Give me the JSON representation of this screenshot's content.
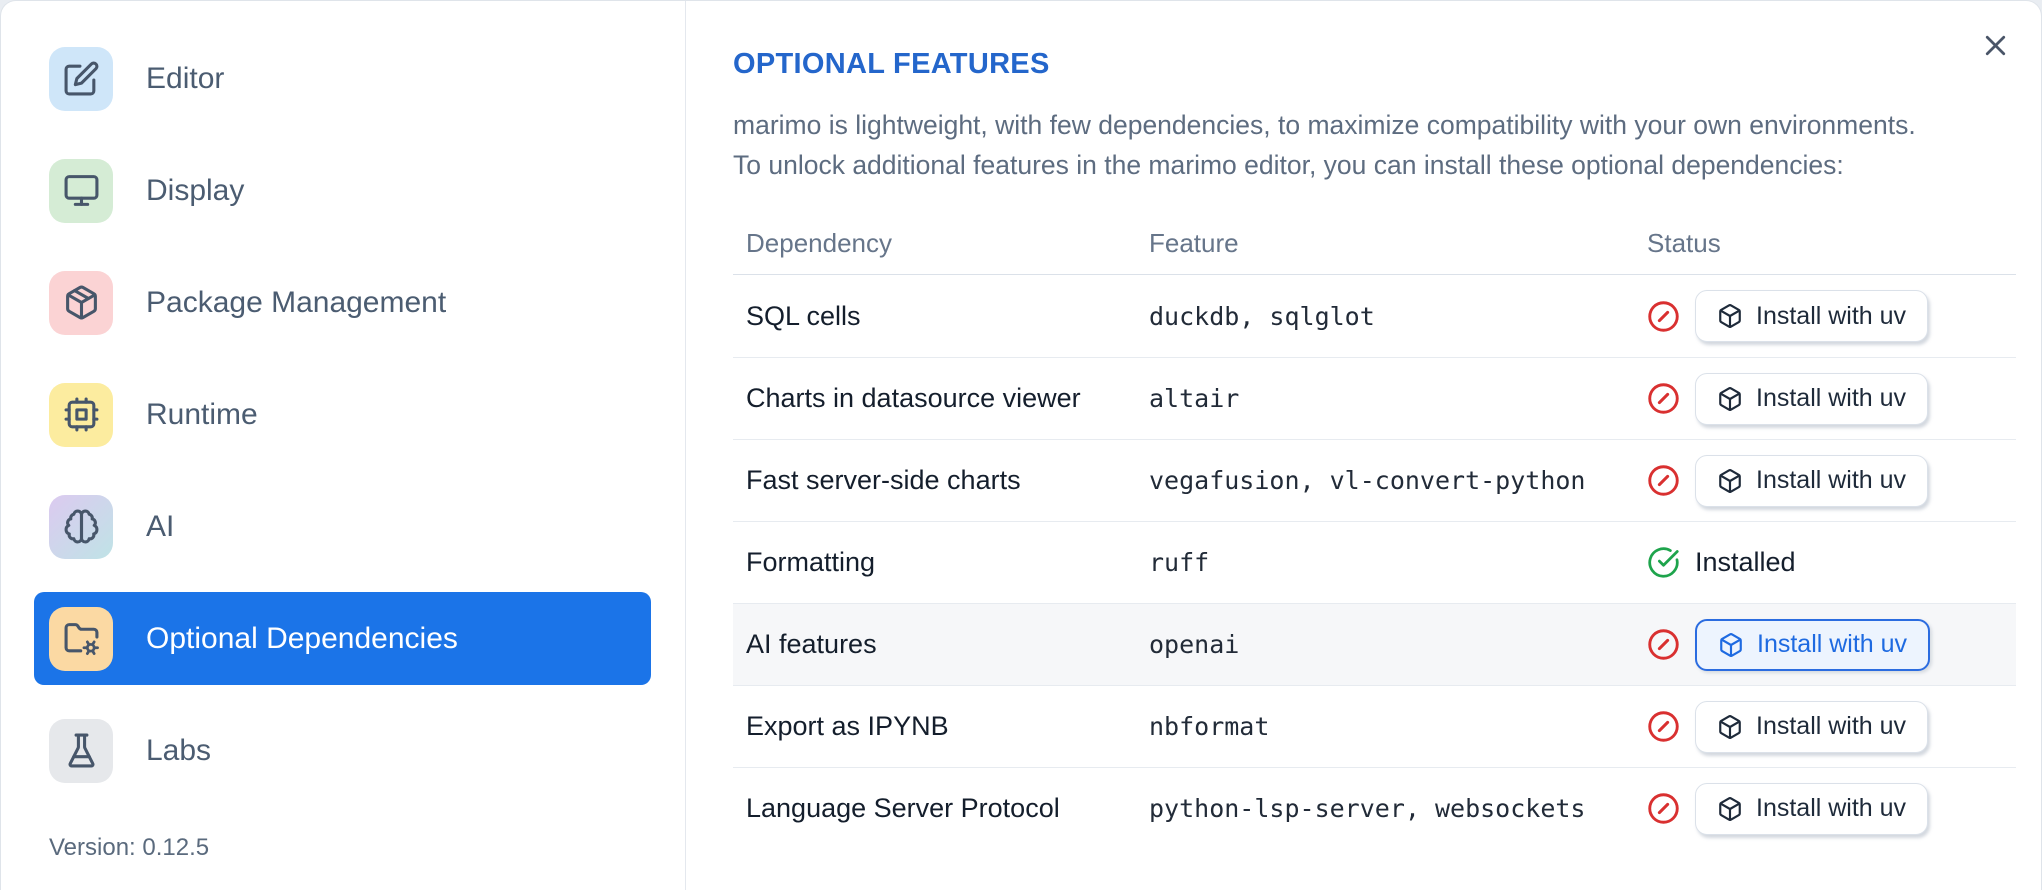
{
  "sidebar": {
    "items": [
      {
        "label": "Editor",
        "icon": "edit-icon",
        "tile_bg": "#cfe6f9"
      },
      {
        "label": "Display",
        "icon": "monitor-icon",
        "tile_bg": "#d5ecd5"
      },
      {
        "label": "Package Management",
        "icon": "package-icon",
        "tile_bg": "#fbd3d4"
      },
      {
        "label": "Runtime",
        "icon": "cpu-icon",
        "tile_bg": "#fcec9f"
      },
      {
        "label": "AI",
        "icon": "brain-icon",
        "tile_bg": "linear-gradient(135deg,#dccaf0 0%,#bfe3e6 100%)"
      },
      {
        "label": "Optional Dependencies",
        "icon": "folder-cog-icon",
        "tile_bg": "#fbd9a3",
        "selected": true
      },
      {
        "label": "Labs",
        "icon": "flask-icon",
        "tile_bg": "#e6e8eb"
      }
    ],
    "version": "Version: 0.12.5"
  },
  "dialog": {
    "title": "OPTIONAL FEATURES",
    "description_line1": "marimo is lightweight, with few dependencies, to maximize compatibility with your own environments.",
    "description_line2": "To unlock additional features in the marimo editor, you can install these optional dependencies:"
  },
  "table": {
    "headers": [
      "Dependency",
      "Feature",
      "Status"
    ],
    "rows": [
      {
        "dependency": "SQL cells",
        "feature": "duckdb, sqlglot",
        "status": "not-installed",
        "action": "Install with uv"
      },
      {
        "dependency": "Charts in datasource viewer",
        "feature": "altair",
        "status": "not-installed",
        "action": "Install with uv"
      },
      {
        "dependency": "Fast server-side charts",
        "feature": "vegafusion, vl-convert-python",
        "status": "not-installed",
        "action": "Install with uv"
      },
      {
        "dependency": "Formatting",
        "feature": "ruff",
        "status": "installed",
        "status_label": "Installed"
      },
      {
        "dependency": "AI features",
        "feature": "openai",
        "status": "not-installed",
        "action": "Install with uv",
        "highlighted": true
      },
      {
        "dependency": "Export as IPYNB",
        "feature": "nbformat",
        "status": "not-installed",
        "action": "Install with uv"
      },
      {
        "dependency": "Language Server Protocol",
        "feature": "python-lsp-server, websockets",
        "status": "not-installed",
        "action": "Install with uv"
      }
    ]
  },
  "colors": {
    "selected_item_blue": "#1b74e8",
    "title_blue": "#2466cb",
    "highlight_button_blue": "#1e6ae1",
    "error_red": "#d93030",
    "success_green": "#1ea44c",
    "sidebar_label": "#4b5c71",
    "body_text": "#5d6c80",
    "table_text": "#141e2c"
  }
}
